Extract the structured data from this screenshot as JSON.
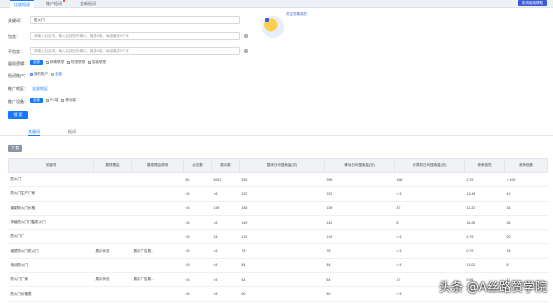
{
  "top_tabs": [
    {
      "label": "比较短语",
      "active": true,
      "dot": false
    },
    {
      "label": "账户拓词",
      "active": false,
      "dot": true
    },
    {
      "label": "全新拓词",
      "active": false,
      "dot": false
    }
  ],
  "help_button": "拓词使用帮助",
  "form": {
    "keyword": {
      "label": "关键词：",
      "value": "防火门"
    },
    "include": {
      "label": "包含：",
      "placeholder": "请输入包含词，输入后按回车确认，最多5组，每组最多5个字"
    },
    "exclude": {
      "label": "不包含：",
      "placeholder": "请输入包含词，输入后按回车确认，最多5组，每组最多5个字"
    },
    "show_filter": {
      "label": "展现逻辑：",
      "options": [
        "全部",
        "精确联想",
        "短语联想",
        "智能联想"
      ]
    },
    "expand_account": {
      "label": "拓词账户：",
      "options": [
        "我的账户",
        "全部"
      ]
    },
    "expand_region": {
      "label": "推广地区：",
      "value": "全部地区"
    },
    "device": {
      "label": "推广设备：",
      "options": [
        "全部",
        "PC端",
        "移动端"
      ]
    },
    "search_button": "搜 索"
  },
  "hero_text": "关注您喜欢的",
  "result_tabs": [
    {
      "label": "关键词",
      "active": true
    },
    {
      "label": "拓词",
      "active": false
    }
  ],
  "download_button": "下 载",
  "table": {
    "headers": [
      "关键词",
      "展现理由",
      "展现理由说明",
      "点击数",
      "展示数",
      "整体日均搜索量(次)",
      "移动日均搜索量(次)",
      "计算机日均搜索量(次)",
      "竞争激烈",
      "竞争指数"
    ],
    "rows": [
      [
        "防火门",
        "",
        "",
        "80",
        "5931",
        "593",
        "399",
        "166",
        "2.75",
        "< 100"
      ],
      [
        "防火门生产厂家",
        "",
        "",
        "<5",
        "<5",
        "222",
        "222",
        "< 5",
        "13.49",
        "41"
      ],
      [
        "钢制防火门价格",
        "",
        "",
        "<5",
        "139",
        "183",
        "139",
        "47",
        "12.22",
        "33"
      ],
      [
        "甲级防火门门槛防火门",
        "",
        "",
        "<5",
        "<5",
        "149",
        "142",
        "8",
        "16.28",
        "28"
      ],
      [
        "防火门厂",
        "",
        "",
        "<5",
        "24",
        "119",
        "119",
        "< 5",
        "4.79",
        "20"
      ],
      [
        "钢质防火门防火门",
        "展示状态",
        "展示广告展...",
        "<5",
        "<5",
        "78",
        "78",
        "< 5",
        "0.79",
        "15"
      ],
      [
        "电动防火门",
        "",
        "",
        "<5",
        "<5",
        "84",
        "84",
        "< 5",
        "13.02",
        "8"
      ],
      [
        "防火门厂家",
        "展示状态",
        "展示广告展...",
        "<5",
        "<5",
        "64",
        "64",
        "17",
        "9.95",
        "17"
      ],
      [
        "防火门价格表",
        "",
        "",
        "<5",
        "<5",
        "60",
        "60",
        "< 5",
        "",
        ""
      ]
    ]
  },
  "watermark": "头条 @A丝路赞学院"
}
